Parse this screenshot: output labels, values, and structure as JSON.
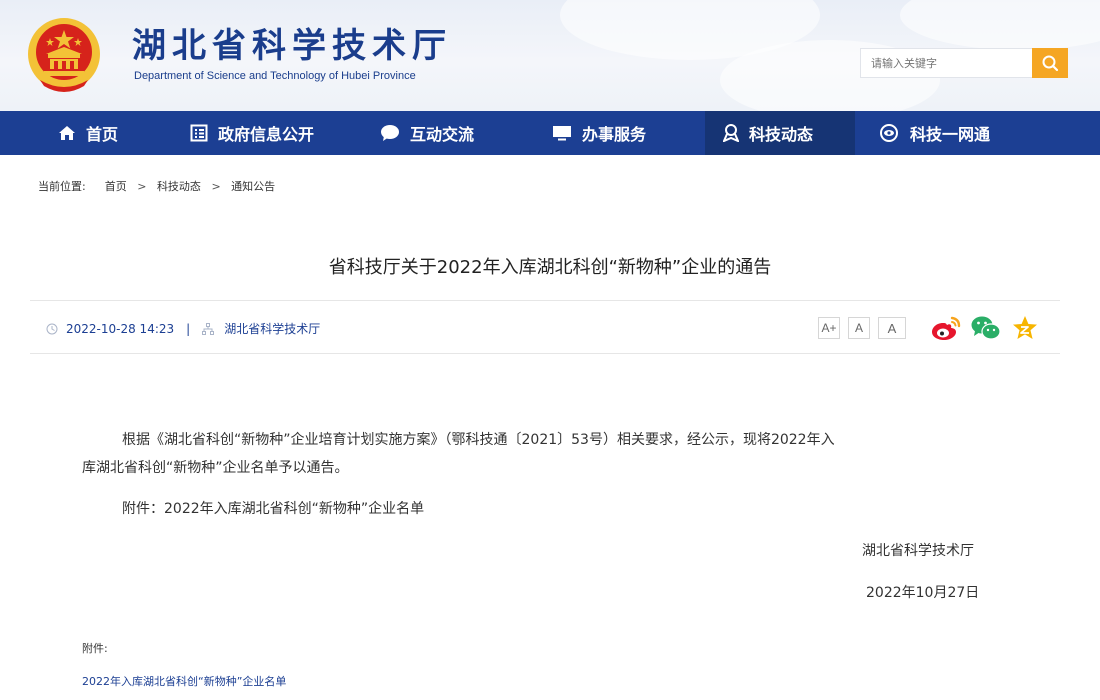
{
  "header": {
    "title": "湖北省科学技术厅",
    "subtitle": "Department of Science and Technology of Hubei Province",
    "search_placeholder": "请输入关键字"
  },
  "nav": {
    "items": [
      {
        "label": "首页",
        "icon": "home-icon"
      },
      {
        "label": "政府信息公开",
        "icon": "document-list-icon"
      },
      {
        "label": "互动交流",
        "icon": "chat-bubble-icon"
      },
      {
        "label": "办事服务",
        "icon": "monitor-icon"
      },
      {
        "label": "科技动态",
        "icon": "award-icon",
        "active": true
      },
      {
        "label": "科技一网通",
        "icon": "eye-icon"
      }
    ]
  },
  "breadcrumb": {
    "prefix": "当前位置:",
    "items": [
      "首页",
      "科技动态",
      "通知公告"
    ],
    "separator": ">"
  },
  "article": {
    "title": "省科技厅关于2022年入库湖北科创“新物种”企业的通告",
    "datetime": "2022-10-28 14:23",
    "meta_separator": "|",
    "source": "湖北省科学技术厅",
    "font_sizes": [
      "A+",
      "A",
      "A"
    ],
    "share_icons": [
      "weibo-icon",
      "wechat-icon",
      "qzone-icon"
    ],
    "body_line1": "根据《湖北省科创“新物种”企业培育计划实施方案》（鄂科技通〔2021〕53号）相关要求，经公示，现将2022年入",
    "body_line2": "库湖北省科创“新物种”企业名单予以通告。",
    "attachment_line": "附件：2022年入库湖北省科创“新物种”企业名单",
    "signature": "湖北省科学技术厅",
    "date": "2022年10月27日"
  },
  "attachments": {
    "label": "附件:",
    "link": "2022年入库湖北省科创“新物种”企业名单"
  },
  "colors": {
    "brand_blue": "#1c3f93",
    "nav_active": "#163474",
    "search_button": "#f5a623",
    "emblem_red": "#d6231b",
    "emblem_gold": "#f3c237"
  }
}
